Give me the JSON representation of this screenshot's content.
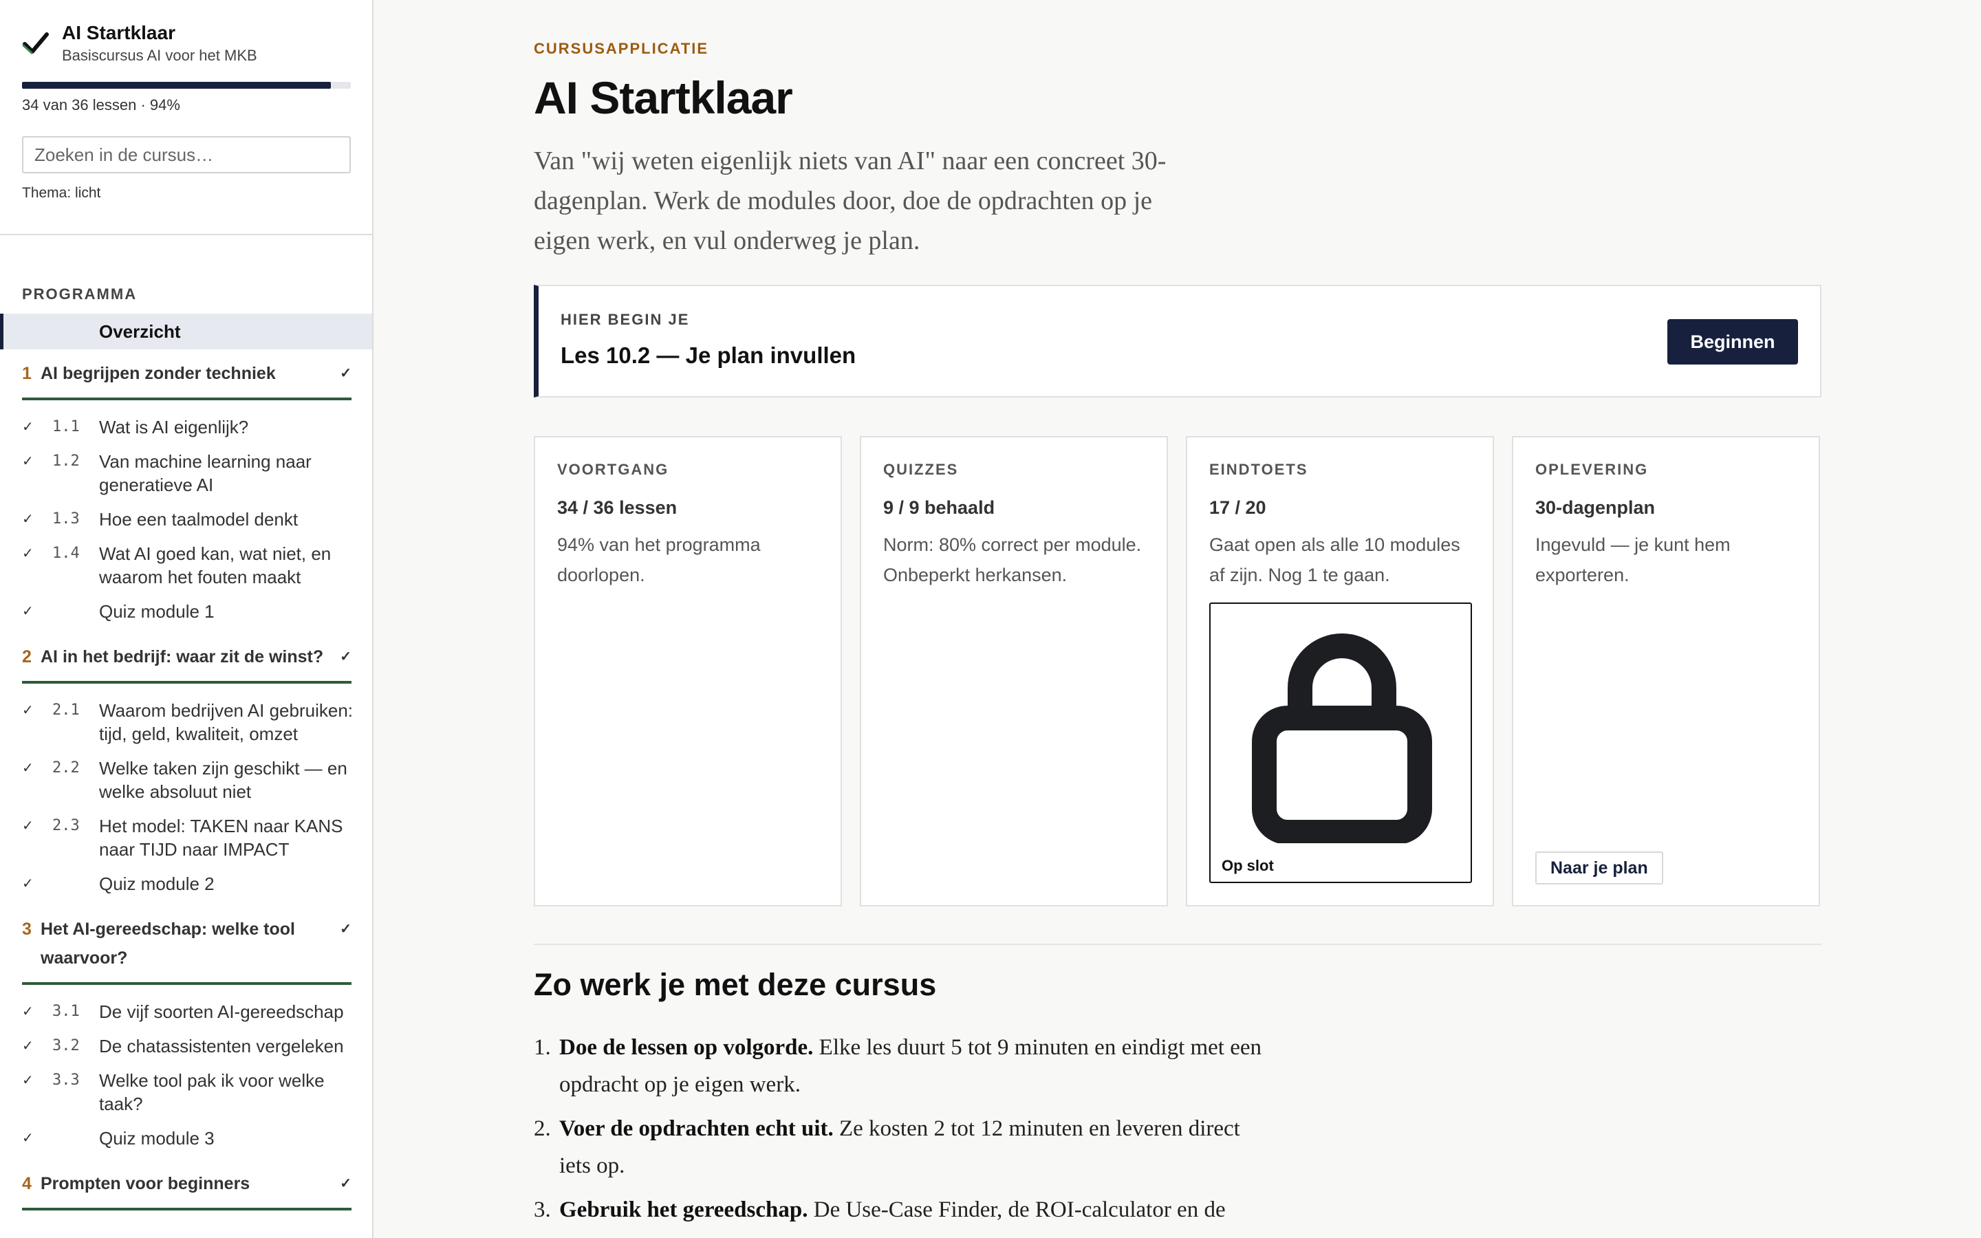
{
  "sidebar": {
    "brand_title": "AI Startklaar",
    "brand_subtitle": "Basiscursus AI voor het MKB",
    "progress_fraction": 0.94,
    "progress_text": "34 van 36 lessen · 94%",
    "search_placeholder": "Zoeken in de cursus…",
    "theme_label": "Thema: licht",
    "nav_heading": "PROGRAMMA",
    "overview_label": "Overzicht",
    "modules": [
      {
        "num": "1",
        "title": "AI begrijpen zonder techniek",
        "check": "✓",
        "lessons": [
          {
            "check": "✓",
            "num": "1.1",
            "title": "Wat is AI eigenlijk?"
          },
          {
            "check": "✓",
            "num": "1.2",
            "title": "Van machine learning naar generatieve AI"
          },
          {
            "check": "✓",
            "num": "1.3",
            "title": "Hoe een taalmodel denkt"
          },
          {
            "check": "✓",
            "num": "1.4",
            "title": "Wat AI goed kan, wat niet, en waarom het fouten maakt"
          },
          {
            "check": "✓",
            "num": "",
            "title": "Quiz module 1"
          }
        ]
      },
      {
        "num": "2",
        "title": "AI in het bedrijf: waar zit de winst?",
        "check": "✓",
        "lessons": [
          {
            "check": "✓",
            "num": "2.1",
            "title": "Waarom bedrijven AI gebruiken: tijd, geld, kwaliteit, omzet"
          },
          {
            "check": "✓",
            "num": "2.2",
            "title": "Welke taken zijn geschikt — en welke absoluut niet"
          },
          {
            "check": "✓",
            "num": "2.3",
            "title": "Het model: TAKEN naar KANS naar TIJD naar IMPACT"
          },
          {
            "check": "✓",
            "num": "",
            "title": "Quiz module 2"
          }
        ]
      },
      {
        "num": "3",
        "title": "Het AI-gereedschap: welke tool waarvoor?",
        "check": "✓",
        "lessons": [
          {
            "check": "✓",
            "num": "3.1",
            "title": "De vijf soorten AI-gereedschap"
          },
          {
            "check": "✓",
            "num": "3.2",
            "title": "De chatassistenten vergeleken"
          },
          {
            "check": "✓",
            "num": "3.3",
            "title": "Welke tool pak ik voor welke taak?"
          },
          {
            "check": "✓",
            "num": "",
            "title": "Quiz module 3"
          }
        ]
      },
      {
        "num": "4",
        "title": "Prompten voor beginners",
        "check": "✓",
        "lessons": []
      }
    ]
  },
  "main": {
    "eyebrow": "CURSUSAPPLICATIE",
    "title": "AI Startklaar",
    "intro": "Van \"wij weten eigenlijk niets van AI\" naar een concreet 30-dagenplan. Werk de modules door, doe de opdrachten op je eigen werk, en vul onderweg je plan.",
    "start": {
      "label": "HIER BEGIN JE",
      "lesson": "Les 10.2 — Je plan invullen",
      "button": "Beginnen"
    },
    "cards": [
      {
        "label": "VOORTGANG",
        "value": "34 / 36 lessen",
        "desc": "94% van het programma doorlopen."
      },
      {
        "label": "QUIZZES",
        "value": "9 / 9 behaald",
        "desc": "Norm: 80% correct per module. Onbeperkt herkansen."
      },
      {
        "label": "EINDTOETS",
        "value": "17 / 20",
        "desc": "Gaat open als alle 10 modules af zijn. Nog 1 te gaan.",
        "lock_caption": "Op slot"
      },
      {
        "label": "OPLEVERING",
        "value": "30-dagenplan",
        "desc": "Ingevuld — je kunt hem exporteren.",
        "link": "Naar je plan"
      }
    ],
    "section_title": "Zo werk je met deze cursus",
    "steps": [
      {
        "num": "1.",
        "strong": "Doe de lessen op volgorde.",
        "text": " Elke les duurt 5 tot 9 minuten en eindigt met een opdracht op je eigen werk."
      },
      {
        "num": "2.",
        "strong": "Voer de opdrachten echt uit.",
        "text": " Ze kosten 2 tot 12 minuten en leveren direct iets op."
      },
      {
        "num": "3.",
        "strong": "Gebruik het gereedschap.",
        "text": " De Use-Case Finder, de ROI-calculator en de"
      }
    ]
  },
  "colors": {
    "accent_navy": "#17213d",
    "module_underline_green": "#2e5b3c",
    "eyebrow_brown": "#9c5b10",
    "module_number_orange": "#a5671c",
    "check_green": "#2e8b57"
  },
  "icons": {
    "brand": "check-icon",
    "lock": "lock-icon",
    "lesson_done": "checkmark-glyph"
  }
}
